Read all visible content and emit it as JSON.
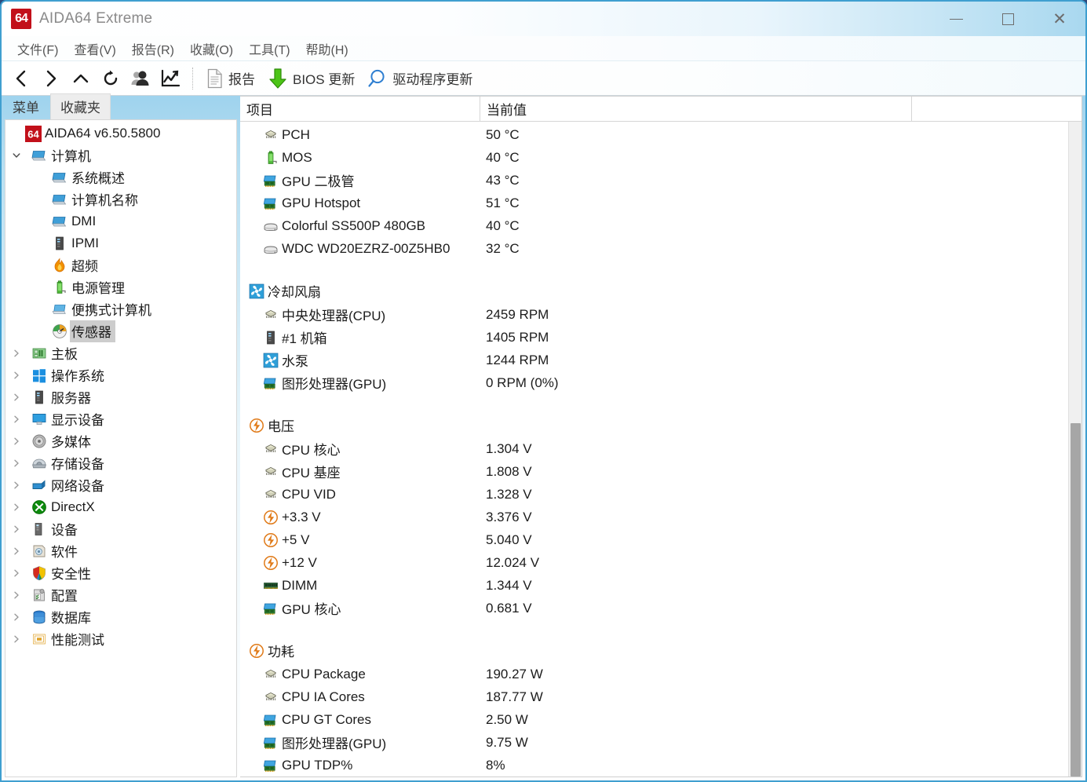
{
  "window": {
    "title": "AIDA64 Extreme",
    "logo_text": "64",
    "minimize_label": "—",
    "maximize_label": "☐",
    "close_label": "✕"
  },
  "menubar": {
    "items": [
      {
        "label": "文件(F)",
        "name": "menu-file"
      },
      {
        "label": "查看(V)",
        "name": "menu-view"
      },
      {
        "label": "报告(R)",
        "name": "menu-report"
      },
      {
        "label": "收藏(O)",
        "name": "menu-favorites"
      },
      {
        "label": "工具(T)",
        "name": "menu-tools"
      },
      {
        "label": "帮助(H)",
        "name": "menu-help"
      }
    ]
  },
  "toolbar": {
    "icon_buttons": [
      {
        "icon": "back-icon",
        "name": "back-button"
      },
      {
        "icon": "forward-icon",
        "name": "forward-button"
      },
      {
        "icon": "up-icon",
        "name": "up-button"
      },
      {
        "icon": "refresh-icon",
        "name": "refresh-button"
      },
      {
        "icon": "users-icon",
        "name": "users-button"
      },
      {
        "icon": "chart-icon",
        "name": "chart-button"
      }
    ],
    "report_label": "报告",
    "bios_update_label": "BIOS 更新",
    "driver_update_label": "驱动程序更新"
  },
  "sidebar": {
    "tabs": [
      {
        "label": "菜单",
        "active": true
      },
      {
        "label": "收藏夹",
        "active": false
      }
    ],
    "root": {
      "label": "AIDA64 v6.50.5800",
      "icon": "aida64-logo-icon"
    },
    "items": [
      {
        "label": "计算机",
        "icon": "computer-icon",
        "indent": 1,
        "expander": "open",
        "selected": false
      },
      {
        "label": "系统概述",
        "icon": "computer-icon",
        "indent": 2,
        "expander": "none",
        "selected": false
      },
      {
        "label": "计算机名称",
        "icon": "computer-icon",
        "indent": 2,
        "expander": "none",
        "selected": false
      },
      {
        "label": "DMI",
        "icon": "computer-icon",
        "indent": 2,
        "expander": "none",
        "selected": false
      },
      {
        "label": "IPMI",
        "icon": "server-icon",
        "indent": 2,
        "expander": "none",
        "selected": false
      },
      {
        "label": "超频",
        "icon": "flame-icon",
        "indent": 2,
        "expander": "none",
        "selected": false
      },
      {
        "label": "电源管理",
        "icon": "battery-icon",
        "indent": 2,
        "expander": "none",
        "selected": false
      },
      {
        "label": "便携式计算机",
        "icon": "laptop-icon",
        "indent": 2,
        "expander": "none",
        "selected": false
      },
      {
        "label": "传感器",
        "icon": "sensor-icon",
        "indent": 2,
        "expander": "none",
        "selected": true
      },
      {
        "label": "主板",
        "icon": "motherboard-icon",
        "indent": 1,
        "expander": "closed",
        "selected": false
      },
      {
        "label": "操作系统",
        "icon": "windows-icon",
        "indent": 1,
        "expander": "closed",
        "selected": false
      },
      {
        "label": "服务器",
        "icon": "server-icon",
        "indent": 1,
        "expander": "closed",
        "selected": false
      },
      {
        "label": "显示设备",
        "icon": "display-icon",
        "indent": 1,
        "expander": "closed",
        "selected": false
      },
      {
        "label": "多媒体",
        "icon": "multimedia-icon",
        "indent": 1,
        "expander": "closed",
        "selected": false
      },
      {
        "label": "存储设备",
        "icon": "storage-icon",
        "indent": 1,
        "expander": "closed",
        "selected": false
      },
      {
        "label": "网络设备",
        "icon": "network-icon",
        "indent": 1,
        "expander": "closed",
        "selected": false
      },
      {
        "label": "DirectX",
        "icon": "directx-icon",
        "indent": 1,
        "expander": "closed",
        "selected": false
      },
      {
        "label": "设备",
        "icon": "device-icon",
        "indent": 1,
        "expander": "closed",
        "selected": false
      },
      {
        "label": "软件",
        "icon": "software-icon",
        "indent": 1,
        "expander": "closed",
        "selected": false
      },
      {
        "label": "安全性",
        "icon": "shield-icon",
        "indent": 1,
        "expander": "closed",
        "selected": false
      },
      {
        "label": "配置",
        "icon": "config-icon",
        "indent": 1,
        "expander": "closed",
        "selected": false
      },
      {
        "label": "数据库",
        "icon": "database-icon",
        "indent": 1,
        "expander": "closed",
        "selected": false
      },
      {
        "label": "性能测试",
        "icon": "benchmark-icon",
        "indent": 1,
        "expander": "closed",
        "selected": false
      }
    ]
  },
  "content": {
    "columns": [
      "项目",
      "当前值",
      ""
    ],
    "groups": [
      {
        "section": null,
        "rows": [
          {
            "icon": "chip-icon",
            "label": "PCH",
            "value": "50 °C"
          },
          {
            "icon": "battery-icon",
            "label": "MOS",
            "value": "40 °C"
          },
          {
            "icon": "gpu-icon",
            "label": "GPU 二极管",
            "value": "43 °C"
          },
          {
            "icon": "gpu-icon",
            "label": "GPU Hotspot",
            "value": "51 °C"
          },
          {
            "icon": "disk-icon",
            "label": "Colorful SS500P 480GB",
            "value": "40 °C"
          },
          {
            "icon": "disk-icon",
            "label": "WDC WD20EZRZ-00Z5HB0",
            "value": "32 °C"
          }
        ]
      },
      {
        "section": {
          "icon": "fan-icon",
          "label": "冷却风扇"
        },
        "rows": [
          {
            "icon": "chip-icon",
            "label": "中央处理器(CPU)",
            "value": "2459 RPM"
          },
          {
            "icon": "server-icon",
            "label": "#1 机箱",
            "value": "1405 RPM"
          },
          {
            "icon": "fan-icon",
            "label": "水泵",
            "value": "1244 RPM"
          },
          {
            "icon": "gpu-icon",
            "label": "图形处理器(GPU)",
            "value": "0 RPM  (0%)"
          }
        ]
      },
      {
        "section": {
          "icon": "bolt-icon",
          "label": "电压"
        },
        "rows": [
          {
            "icon": "chip-icon",
            "label": "CPU 核心",
            "value": "1.304 V"
          },
          {
            "icon": "chip-icon",
            "label": "CPU 基座",
            "value": "1.808 V"
          },
          {
            "icon": "chip-icon",
            "label": "CPU VID",
            "value": "1.328 V"
          },
          {
            "icon": "bolt-icon",
            "label": "+3.3 V",
            "value": "3.376 V"
          },
          {
            "icon": "bolt-icon",
            "label": "+5 V",
            "value": "5.040 V"
          },
          {
            "icon": "bolt-icon",
            "label": "+12 V",
            "value": "12.024 V"
          },
          {
            "icon": "dimm-icon",
            "label": "DIMM",
            "value": "1.344 V"
          },
          {
            "icon": "gpu-icon",
            "label": "GPU 核心",
            "value": "0.681 V"
          }
        ]
      },
      {
        "section": {
          "icon": "bolt-icon",
          "label": "功耗"
        },
        "rows": [
          {
            "icon": "chip-icon",
            "label": "CPU Package",
            "value": "190.27 W"
          },
          {
            "icon": "chip-icon",
            "label": "CPU IA Cores",
            "value": "187.77 W"
          },
          {
            "icon": "gpu-icon",
            "label": "CPU GT Cores",
            "value": "2.50 W"
          },
          {
            "icon": "gpu-icon",
            "label": "图形处理器(GPU)",
            "value": "9.75 W"
          },
          {
            "icon": "gpu-icon",
            "label": "GPU TDP%",
            "value": "8%"
          }
        ]
      }
    ]
  },
  "scrollbar": {
    "thumb_top_pct": 46,
    "thumb_height_pct": 54
  },
  "colors": {
    "accent": "#3f9fd0",
    "logo_red": "#c2101a",
    "selection_gray": "#cdcdcd",
    "bios_green": "#38b000"
  }
}
